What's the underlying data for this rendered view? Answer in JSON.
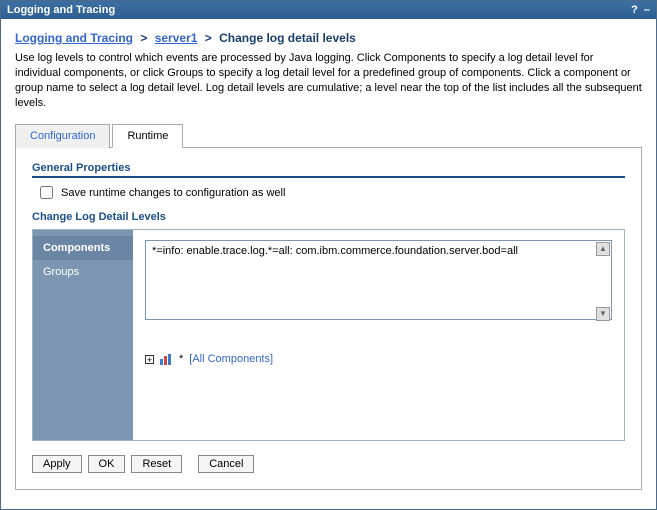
{
  "window": {
    "title": "Logging and Tracing"
  },
  "breadcrumb": {
    "root": "Logging and Tracing",
    "server": "server1",
    "current": "Change log detail levels"
  },
  "description": "Use log levels to control which events are processed by Java logging. Click Components to specify a log detail level for individual components, or click Groups to specify a log detail level for a predefined group of components. Click a component or group name to select a log detail level. Log detail levels are cumulative; a level near the top of the list includes all the subsequent levels.",
  "tabs": {
    "configuration": "Configuration",
    "runtime": "Runtime"
  },
  "section": {
    "general": "General Properties",
    "save_label": "Save runtime changes to configuration as well",
    "change_title": "Change Log Detail Levels"
  },
  "sidenav": {
    "components": "Components",
    "groups": "Groups"
  },
  "trace": {
    "value": "*=info: enable.trace.log.*=all: com.ibm.commerce.foundation.server.bod=all"
  },
  "tree": {
    "star": "*",
    "all_components": "[All Components]"
  },
  "buttons": {
    "apply": "Apply",
    "ok": "OK",
    "reset": "Reset",
    "cancel": "Cancel"
  }
}
